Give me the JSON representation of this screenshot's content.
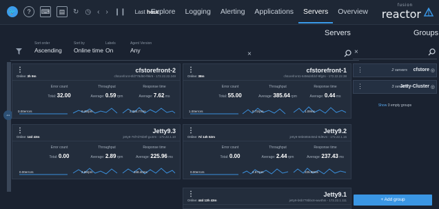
{
  "brand": {
    "word": "reactor",
    "fusion": "fusion"
  },
  "nav": [
    {
      "label": "Overview",
      "active": false
    },
    {
      "label": "Servers",
      "active": true
    },
    {
      "label": "Applications",
      "active": false
    },
    {
      "label": "Alerting",
      "active": false
    },
    {
      "label": "Logging",
      "active": false
    },
    {
      "label": "Explore",
      "active": false
    }
  ],
  "timebar": {
    "last_label": "Last",
    "last_value": "hour"
  },
  "headers": {
    "servers": "Servers",
    "groups": "Groups"
  },
  "filters": [
    {
      "label": "Agent Version",
      "value": "Any"
    },
    {
      "label": "Labels",
      "value": "On"
    },
    {
      "label": "Sort by",
      "value": "Online time"
    },
    {
      "label": "Sort order",
      "value": "Ascending"
    }
  ],
  "search": {
    "clear": "×"
  },
  "cards": [
    {
      "name": "cfstorefront-1",
      "sub": "cfstorefront1-6456d4fdcf-9fg2s - 172.22.22.38",
      "online_label": "Online:",
      "online": "38m",
      "resp_label": "Response time",
      "resp_avg": "Average:",
      "resp_val": "0.44",
      "resp_unit": "ms",
      "thr_label": "Throughput",
      "thr_avg": "Average:",
      "thr_val": "385.64",
      "thr_unit": "rpm",
      "err_label": "Error count",
      "err_total": "Total:",
      "err_val": "55.00",
      "l1": "1.09ms",
      "l2": "0.72rpm",
      "l3": "1.00errors"
    },
    {
      "name": "cfstorefront-2",
      "sub": "cfstorefront-6fd778d50-f9kr6 - 172.22.22.249",
      "online_label": "Online:",
      "online": "3h 9m",
      "resp_label": "Response time",
      "resp_avg": "Average:",
      "resp_val": "7.62",
      "resp_unit": "ms",
      "thr_label": "Throughput",
      "thr_avg": "Average:",
      "thr_val": "0.59",
      "thr_unit": "rpm",
      "err_label": "Error count",
      "err_total": "Total:",
      "err_val": "32.00",
      "l1": "2,384.77ms",
      "l2": "0.45rpm",
      "l3": "0.00errors"
    },
    {
      "name": "Jetty9.2",
      "sub": "jetty9-58b6856456d-8d9vm - 172.22.1.15",
      "online_label": "Online:",
      "online": "7d 14h 52m",
      "resp_label": "Response time",
      "resp_avg": "Average:",
      "resp_val": "237.43",
      "resp_unit": "ms",
      "thr_label": "Throughput",
      "thr_avg": "Average:",
      "thr_val": "2.44",
      "thr_unit": "rpm",
      "err_label": "Error count",
      "err_total": "Total:",
      "err_val": "0.00",
      "l1": "225.88ms",
      "l2": "2.97rpm",
      "l3": "0.00errors"
    },
    {
      "name": "Jetty9.3",
      "sub": "jetty9-76f7d76b8f-gx4rm - 172.22.1.10",
      "online_label": "Online:",
      "online": "14d 43m",
      "resp_label": "Response time",
      "resp_avg": "Average:",
      "resp_val": "225.96",
      "resp_unit": "ms",
      "thr_label": "Throughput",
      "thr_avg": "Average:",
      "thr_val": "2.89",
      "thr_unit": "rpm",
      "err_label": "Error count",
      "err_total": "Total:",
      "err_val": "0.00",
      "l1": "348.40ms",
      "l2": "2.98rpm",
      "l3": "0.00errors"
    },
    {
      "name": "Jetty9.1",
      "sub": "jetty9-b6b778bbc8-ww4hm - 172.22.1.111",
      "online_label": "Online:",
      "online": "44d 13h 43m"
    }
  ],
  "groups": [
    {
      "name": "cfstore",
      "count": "2 servers"
    },
    {
      "name": "Jetty-Cluster",
      "count": "3 servers"
    }
  ],
  "show_empty": {
    "link": "Show",
    "rest": "3 empty groups"
  },
  "add_group": "+ Add group",
  "colors": {
    "accent": "#3a96e4",
    "spark": "#3a8fdc",
    "bg": "#1a2230",
    "card": "#232d3c"
  }
}
